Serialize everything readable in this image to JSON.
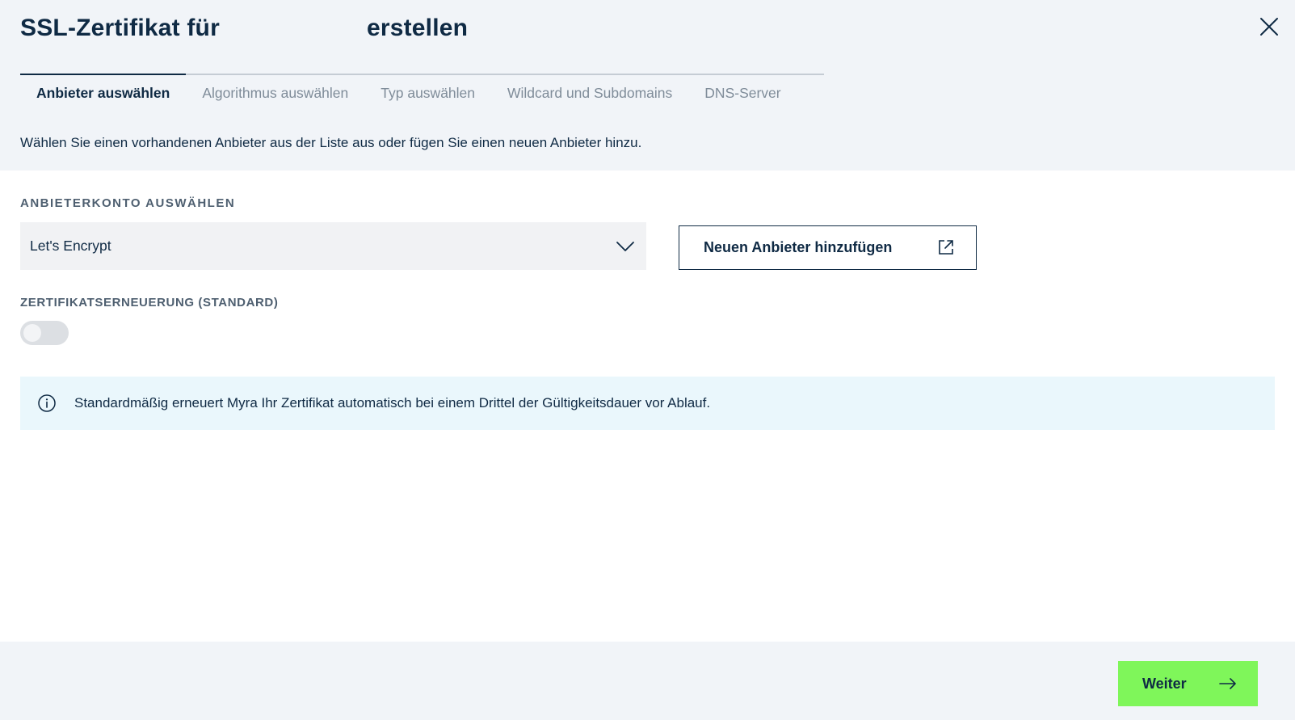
{
  "header": {
    "title_prefix": "SSL-Zertifikat für",
    "title_suffix": "erstellen"
  },
  "tabs": [
    {
      "label": "Anbieter auswählen",
      "active": true
    },
    {
      "label": "Algorithmus auswählen",
      "active": false
    },
    {
      "label": "Typ auswählen",
      "active": false
    },
    {
      "label": "Wildcard und Subdomains",
      "active": false
    },
    {
      "label": "DNS-Server",
      "active": false
    }
  ],
  "intro_text": "Wählen Sie einen vorhandenen Anbieter aus der Liste aus oder fügen Sie einen neuen Anbieter hinzu.",
  "provider": {
    "label": "ANBIETERKONTO AUSWÄHLEN",
    "selected": "Let's Encrypt",
    "add_button": "Neuen Anbieter hinzufügen"
  },
  "renewal": {
    "label": "ZERTIFIKATSERNEUERUNG (STANDARD)",
    "enabled": false
  },
  "info_text": "Standardmäßig erneuert Myra Ihr Zertifikat automatisch bei einem Drittel der Gültigkeitsdauer vor Ablauf.",
  "footer": {
    "next_label": "Weiter"
  },
  "icons": {
    "close": "close-icon",
    "chevron": "chevron-down-icon",
    "external": "external-link-icon",
    "info": "info-icon",
    "arrow": "arrow-right-icon"
  },
  "colors": {
    "primary": "#0f2a44",
    "accent": "#7ff65a",
    "header_bg": "#f1f4f8",
    "info_bg": "#eaf7fc"
  }
}
